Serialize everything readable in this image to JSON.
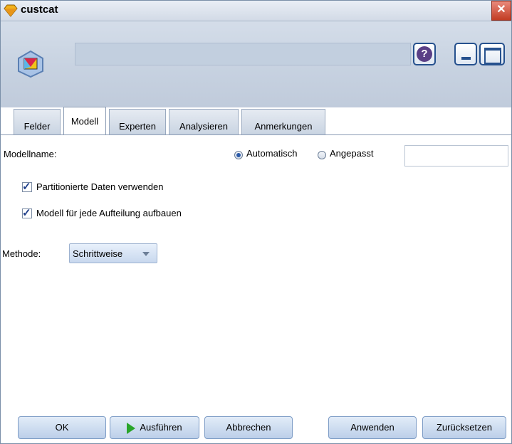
{
  "window": {
    "title": "custcat",
    "close_symbol": "✕"
  },
  "header": {
    "help_symbol": "?"
  },
  "tabs": [
    {
      "label": "Felder",
      "active": false
    },
    {
      "label": "Modell",
      "active": true
    },
    {
      "label": "Experten",
      "active": false
    },
    {
      "label": "Analysieren",
      "active": false
    },
    {
      "label": "Anmerkungen",
      "active": false
    }
  ],
  "model": {
    "name_label": "Modellname:",
    "radio_auto": {
      "label": "Automatisch",
      "selected": true
    },
    "radio_custom": {
      "label": "Angepasst",
      "selected": false
    },
    "custom_name_value": "",
    "use_partitioned": {
      "label": "Partitionierte Daten verwenden",
      "checked": true
    },
    "build_per_split": {
      "label": "Modell für jede Aufteilung aufbauen",
      "checked": true
    },
    "method_label": "Methode:",
    "method_value": "Schrittweise"
  },
  "buttons": {
    "ok": "OK",
    "run": "Ausführen",
    "cancel": "Abbrechen",
    "apply": "Anwenden",
    "reset": "Zurücksetzen"
  },
  "colors": {
    "header_bg": "#c6d1e0",
    "run_icon": "#2aa52a",
    "help_icon": "#5a3f86"
  }
}
